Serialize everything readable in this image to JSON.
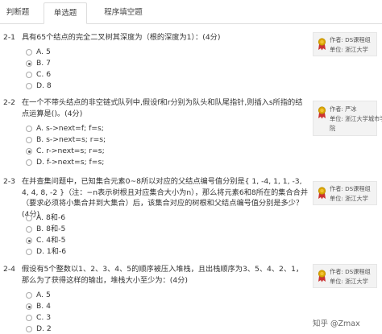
{
  "tabs": [
    "判断题",
    "单选题",
    "程序填空题"
  ],
  "questions": [
    {
      "num": "2-1",
      "text": "具有65个结点的完全二叉树其深度为（根的深度为1）：(4分)",
      "options": [
        {
          "label": "A. 5",
          "selected": false
        },
        {
          "label": "B. 7",
          "selected": true
        },
        {
          "label": "C. 6",
          "selected": false
        },
        {
          "label": "D. 8",
          "selected": false
        }
      ],
      "author": {
        "line1": "作者: DS课程组",
        "line2": "单位: 浙江大学"
      }
    },
    {
      "num": "2-2",
      "text": "在一个不带头结点的非空链式队列中,假设f和r分别为队头和队尾指针,则插入s所指的结点运算是()。(4分)",
      "options": [
        {
          "label": "A. s->next=f; f=s;",
          "selected": false
        },
        {
          "label": "B. s->next=s; r=s;",
          "selected": false
        },
        {
          "label": "C. r->next=s; r=s;",
          "selected": true
        },
        {
          "label": "D. f->next=s; f=s;",
          "selected": false
        }
      ],
      "author": {
        "line1": "作者: 严冰",
        "line2": "单位: 浙江大学城市学",
        "line3": "院"
      }
    },
    {
      "num": "2-3",
      "text": "在并查集问题中，已知集合元素0~8所以对应的父结点编号值分别是{ 1, -4, 1, 1, -3, 4, 4, 8, -2 }（注：−n表示树根且对应集合大小为n），那么将元素6和8所在的集合合并（要求必须将小集合并到大集合）后，该集合对应的树根和父结点编号值分别是多少？(4分)",
      "options": [
        {
          "label": "A. 8和-6",
          "selected": false
        },
        {
          "label": "B. 8和-5",
          "selected": false
        },
        {
          "label": "C. 4和-5",
          "selected": true
        },
        {
          "label": "D. 1和-6",
          "selected": false
        }
      ],
      "author": {
        "line1": "作者: DS课程组",
        "line2": "单位: 浙江大学"
      }
    },
    {
      "num": "2-4",
      "text": "假设有5个整数以1、2、3、4、5的顺序被压入堆栈，且出栈顺序为3、5、4、2、1，那么为了获得这样的输出，堆栈大小至少为：(4分)",
      "options": [
        {
          "label": "A. 5",
          "selected": false
        },
        {
          "label": "B. 4",
          "selected": true
        },
        {
          "label": "C. 3",
          "selected": false
        },
        {
          "label": "D. 2",
          "selected": false
        }
      ],
      "author": {
        "line1": "作者: DS课程组",
        "line2": "单位: 浙江大学"
      }
    }
  ],
  "watermark": "知乎 @Zmax",
  "colors": {
    "award_badge": "#d9a400",
    "award_ribbon": "#c33",
    "radio_border": "#aaaaaa"
  }
}
